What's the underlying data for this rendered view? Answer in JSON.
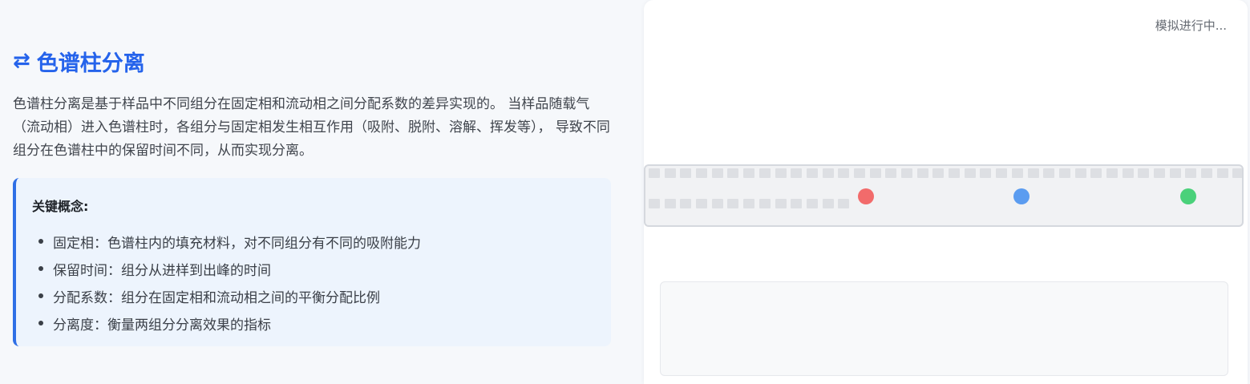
{
  "section": {
    "icon": "swap-arrows-icon",
    "icon_glyph": "⇄",
    "title": "色谱柱分离",
    "description": "色谱柱分离是基于样品中不同组分在固定相和流动相之间分配系数的差异实现的。 当样品随载气（流动相）进入色谱柱时，各组分与固定相发生相互作用（吸附、脱附、溶解、挥发等）， 导致不同组分在色谱柱中的保留时间不同，从而实现分离。"
  },
  "concepts": {
    "title": "关键概念:",
    "items": [
      "固定相：色谱柱内的填充材料，对不同组分有不同的吸附能力",
      "保留时间：组分从进样到出峰的时间",
      "分配系数：组分在固定相和流动相之间的平衡分配比例",
      "分离度：衡量两组分分离效果的指标"
    ]
  },
  "simulation": {
    "status": "模拟进行中...",
    "packing_top_count": 38,
    "packing_bottom_count": 13,
    "molecules": [
      {
        "name": "component-red",
        "color": "#f26b6b",
        "progress": 0.37
      },
      {
        "name": "component-blue",
        "color": "#5b9cf0",
        "progress": 0.63
      },
      {
        "name": "component-green",
        "color": "#4ad17a",
        "progress": 0.91
      }
    ]
  },
  "colors": {
    "accent": "#2563eb",
    "concept_border": "#2f6fe6",
    "concept_bg": "#edf4fd"
  }
}
